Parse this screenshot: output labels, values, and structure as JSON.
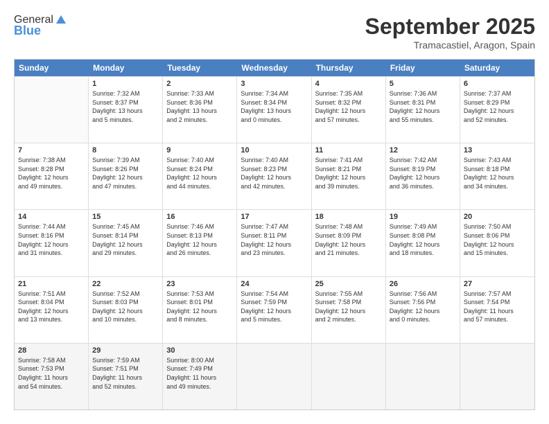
{
  "header": {
    "logo_general": "General",
    "logo_blue": "Blue",
    "month_title": "September 2025",
    "location": "Tramacastiel, Aragon, Spain"
  },
  "days_of_week": [
    "Sunday",
    "Monday",
    "Tuesday",
    "Wednesday",
    "Thursday",
    "Friday",
    "Saturday"
  ],
  "weeks": [
    {
      "days": [
        {
          "num": "",
          "info": ""
        },
        {
          "num": "1",
          "info": "Sunrise: 7:32 AM\nSunset: 8:37 PM\nDaylight: 13 hours\nand 5 minutes."
        },
        {
          "num": "2",
          "info": "Sunrise: 7:33 AM\nSunset: 8:36 PM\nDaylight: 13 hours\nand 2 minutes."
        },
        {
          "num": "3",
          "info": "Sunrise: 7:34 AM\nSunset: 8:34 PM\nDaylight: 13 hours\nand 0 minutes."
        },
        {
          "num": "4",
          "info": "Sunrise: 7:35 AM\nSunset: 8:32 PM\nDaylight: 12 hours\nand 57 minutes."
        },
        {
          "num": "5",
          "info": "Sunrise: 7:36 AM\nSunset: 8:31 PM\nDaylight: 12 hours\nand 55 minutes."
        },
        {
          "num": "6",
          "info": "Sunrise: 7:37 AM\nSunset: 8:29 PM\nDaylight: 12 hours\nand 52 minutes."
        }
      ]
    },
    {
      "days": [
        {
          "num": "7",
          "info": "Sunrise: 7:38 AM\nSunset: 8:28 PM\nDaylight: 12 hours\nand 49 minutes."
        },
        {
          "num": "8",
          "info": "Sunrise: 7:39 AM\nSunset: 8:26 PM\nDaylight: 12 hours\nand 47 minutes."
        },
        {
          "num": "9",
          "info": "Sunrise: 7:40 AM\nSunset: 8:24 PM\nDaylight: 12 hours\nand 44 minutes."
        },
        {
          "num": "10",
          "info": "Sunrise: 7:40 AM\nSunset: 8:23 PM\nDaylight: 12 hours\nand 42 minutes."
        },
        {
          "num": "11",
          "info": "Sunrise: 7:41 AM\nSunset: 8:21 PM\nDaylight: 12 hours\nand 39 minutes."
        },
        {
          "num": "12",
          "info": "Sunrise: 7:42 AM\nSunset: 8:19 PM\nDaylight: 12 hours\nand 36 minutes."
        },
        {
          "num": "13",
          "info": "Sunrise: 7:43 AM\nSunset: 8:18 PM\nDaylight: 12 hours\nand 34 minutes."
        }
      ]
    },
    {
      "days": [
        {
          "num": "14",
          "info": "Sunrise: 7:44 AM\nSunset: 8:16 PM\nDaylight: 12 hours\nand 31 minutes."
        },
        {
          "num": "15",
          "info": "Sunrise: 7:45 AM\nSunset: 8:14 PM\nDaylight: 12 hours\nand 29 minutes."
        },
        {
          "num": "16",
          "info": "Sunrise: 7:46 AM\nSunset: 8:13 PM\nDaylight: 12 hours\nand 26 minutes."
        },
        {
          "num": "17",
          "info": "Sunrise: 7:47 AM\nSunset: 8:11 PM\nDaylight: 12 hours\nand 23 minutes."
        },
        {
          "num": "18",
          "info": "Sunrise: 7:48 AM\nSunset: 8:09 PM\nDaylight: 12 hours\nand 21 minutes."
        },
        {
          "num": "19",
          "info": "Sunrise: 7:49 AM\nSunset: 8:08 PM\nDaylight: 12 hours\nand 18 minutes."
        },
        {
          "num": "20",
          "info": "Sunrise: 7:50 AM\nSunset: 8:06 PM\nDaylight: 12 hours\nand 15 minutes."
        }
      ]
    },
    {
      "days": [
        {
          "num": "21",
          "info": "Sunrise: 7:51 AM\nSunset: 8:04 PM\nDaylight: 12 hours\nand 13 minutes."
        },
        {
          "num": "22",
          "info": "Sunrise: 7:52 AM\nSunset: 8:03 PM\nDaylight: 12 hours\nand 10 minutes."
        },
        {
          "num": "23",
          "info": "Sunrise: 7:53 AM\nSunset: 8:01 PM\nDaylight: 12 hours\nand 8 minutes."
        },
        {
          "num": "24",
          "info": "Sunrise: 7:54 AM\nSunset: 7:59 PM\nDaylight: 12 hours\nand 5 minutes."
        },
        {
          "num": "25",
          "info": "Sunrise: 7:55 AM\nSunset: 7:58 PM\nDaylight: 12 hours\nand 2 minutes."
        },
        {
          "num": "26",
          "info": "Sunrise: 7:56 AM\nSunset: 7:56 PM\nDaylight: 12 hours\nand 0 minutes."
        },
        {
          "num": "27",
          "info": "Sunrise: 7:57 AM\nSunset: 7:54 PM\nDaylight: 11 hours\nand 57 minutes."
        }
      ]
    },
    {
      "days": [
        {
          "num": "28",
          "info": "Sunrise: 7:58 AM\nSunset: 7:53 PM\nDaylight: 11 hours\nand 54 minutes."
        },
        {
          "num": "29",
          "info": "Sunrise: 7:59 AM\nSunset: 7:51 PM\nDaylight: 11 hours\nand 52 minutes."
        },
        {
          "num": "30",
          "info": "Sunrise: 8:00 AM\nSunset: 7:49 PM\nDaylight: 11 hours\nand 49 minutes."
        },
        {
          "num": "",
          "info": ""
        },
        {
          "num": "",
          "info": ""
        },
        {
          "num": "",
          "info": ""
        },
        {
          "num": "",
          "info": ""
        }
      ]
    }
  ]
}
